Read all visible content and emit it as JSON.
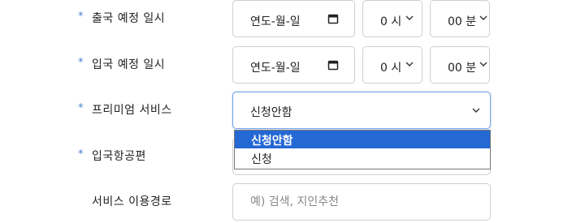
{
  "required_mark": "*",
  "departure": {
    "label": "출국 예정 일시",
    "date_value": "연도-월-일",
    "hour_value": "0 시",
    "minute_value": "00 분"
  },
  "arrival": {
    "label": "입국 예정 일시",
    "date_value": "연도-월-일",
    "hour_value": "0 시",
    "minute_value": "00 분"
  },
  "premium": {
    "label": "프리미엄 서비스",
    "selected": "신청안함",
    "options": [
      "신청안함",
      "신청"
    ]
  },
  "arrival_airport": {
    "label": "입국항공편"
  },
  "route": {
    "label": "서비스 이용경로",
    "placeholder": "예) 검색, 지인추천"
  },
  "colors": {
    "required_mark": "#4a7fd0",
    "option_highlight": "#2468d4",
    "focus_border": "#7aa7e6"
  }
}
